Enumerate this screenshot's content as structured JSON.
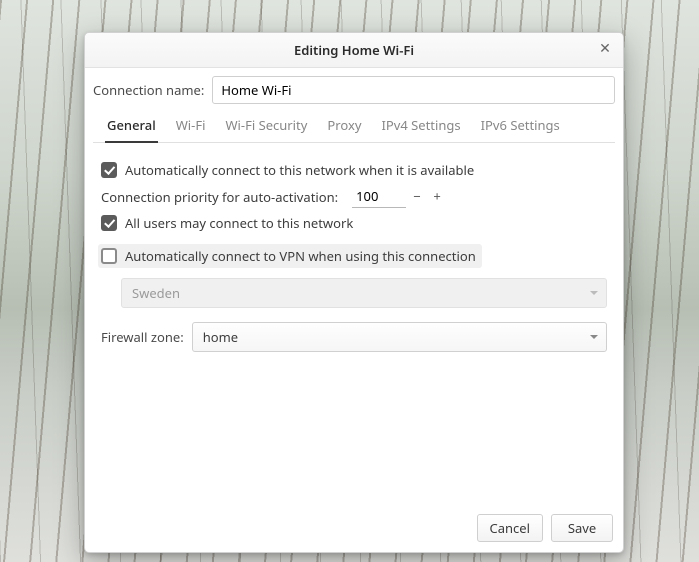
{
  "window": {
    "title": "Editing Home Wi-Fi"
  },
  "form": {
    "connection_name_label": "Connection name:",
    "connection_name_value": "Home Wi-Fi"
  },
  "tabs": [
    {
      "label": "General",
      "active": true
    },
    {
      "label": "Wi-Fi",
      "active": false
    },
    {
      "label": "Wi-Fi Security",
      "active": false
    },
    {
      "label": "Proxy",
      "active": false
    },
    {
      "label": "IPv4 Settings",
      "active": false
    },
    {
      "label": "IPv6 Settings",
      "active": false
    }
  ],
  "general": {
    "auto_connect_label": "Automatically connect to this network when it is available",
    "auto_connect_checked": true,
    "priority_label": "Connection priority for auto-activation:",
    "priority_value": "100",
    "all_users_label": "All users may connect to this network",
    "all_users_checked": true,
    "vpn_label": "Automatically connect to VPN when using this connection",
    "vpn_checked": false,
    "vpn_select_value": "Sweden",
    "vpn_select_enabled": false,
    "firewall_label": "Firewall zone:",
    "firewall_value": "home"
  },
  "footer": {
    "cancel": "Cancel",
    "save": "Save"
  },
  "icons": {
    "close": "close-icon",
    "minus": "minus-icon",
    "plus": "plus-icon",
    "caret": "caret-down-icon"
  }
}
